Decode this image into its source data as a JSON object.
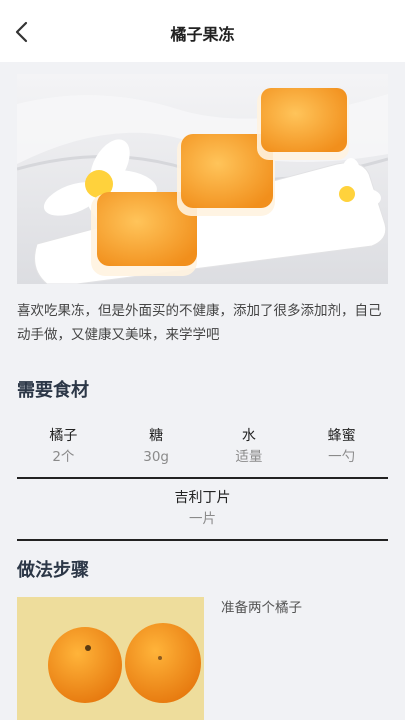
{
  "header": {
    "title": "橘子果冻"
  },
  "description": "喜欢吃果冻，但是外面买的不健康，添加了很多添加剂，自己动手做，又健康又美味，来学学吧",
  "ingredients": {
    "title": "需要食材",
    "items": [
      {
        "name": "橘子",
        "qty": "2个"
      },
      {
        "name": "糖",
        "qty": "30g"
      },
      {
        "name": "水",
        "qty": "适量"
      },
      {
        "name": "蜂蜜",
        "qty": "一勺"
      },
      {
        "name": "吉利丁片",
        "qty": "一片"
      }
    ]
  },
  "steps": {
    "title": "做法步骤",
    "items": [
      {
        "text": "准备两个橘子"
      }
    ]
  },
  "colors": {
    "jelly": "#f6a435",
    "background": "#f1f2f5",
    "heading": "#2c3747"
  },
  "icons": {
    "back": "chevron-left-icon"
  }
}
